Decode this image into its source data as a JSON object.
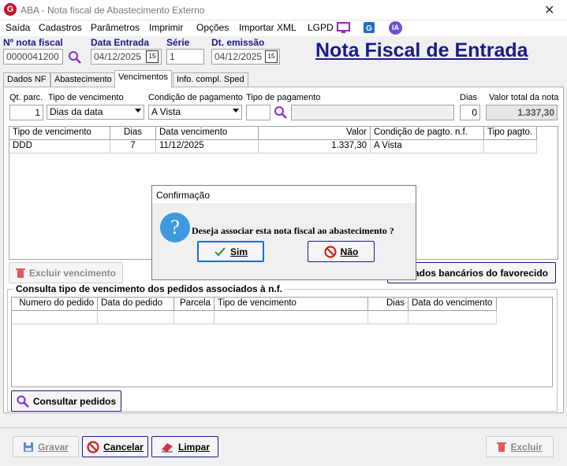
{
  "window": {
    "title": "ABA - Nota fiscal de Abastecimento Externo",
    "close_glyph": "✕",
    "app_icon_letter": "G"
  },
  "menu": {
    "items": [
      "Saída",
      "Cadastros",
      "Parâmetros",
      "Imprimir",
      "Opções",
      "Importar XML",
      "LGPD"
    ],
    "ia_badge": "IA"
  },
  "header": {
    "nota_label": "Nº nota fiscal",
    "nota_value": "0000041200",
    "entrada_label": "Data Entrada",
    "entrada_value": "04/12/2025",
    "serie_label": "Série",
    "serie_value": "1",
    "emissao_label": "Dt. emissão",
    "emissao_value": "04/12/2025",
    "big_title": "Nota Fiscal de Entrada",
    "cal_text": "15"
  },
  "tabs": [
    "Dados NF",
    "Abastecimento",
    "Vencimentos",
    "Info. compl. Sped"
  ],
  "form": {
    "qt_label": "Qt. parc.",
    "qt_value": "1",
    "tipo_venc_label": "Tipo de vencimento",
    "tipo_venc_value": "Dias da data",
    "cond_label": "Condição de pagamento",
    "cond_value": "A Vista",
    "tipo_pag_label": "Tipo de pagamento",
    "dias_label": "Dias",
    "dias_value": "0",
    "valor_label": "Valor total da nota",
    "valor_value": "1.337,30"
  },
  "venc_table": {
    "headers": [
      "Tipo de vencimento",
      "Dias",
      "Data vencimento",
      "Valor",
      "Condição de pagto. n.f.",
      "Tipo pagto."
    ],
    "row": [
      "DDD",
      "7",
      "11/12/2025",
      "1.337,30",
      "A Vista",
      ""
    ]
  },
  "buttons": {
    "excluir_venc": "Excluir vencimento",
    "dados_bancarios": "dados bancários do favorecido",
    "consultar": "Consultar pedidos",
    "gravar": "Gravar",
    "cancelar": "Cancelar",
    "limpar": "Limpar",
    "excluir": "Excluir"
  },
  "consulta": {
    "title": "Consulta tipo de vencimento dos pedidos associados à n.f.",
    "headers": [
      "Numero do pedido",
      "Data do pedido",
      "Parcela",
      "Tipo de vencimento",
      "Dias",
      "Data do vencimento"
    ]
  },
  "dialog": {
    "title": "Confirmação",
    "message": "Deseja associar esta nota fiscal ao abastecimento ?",
    "yes": "Sim",
    "no": "Não",
    "q": "?"
  },
  "colors": {
    "accent": "#1a1a8c",
    "brand": "#c8102e"
  }
}
